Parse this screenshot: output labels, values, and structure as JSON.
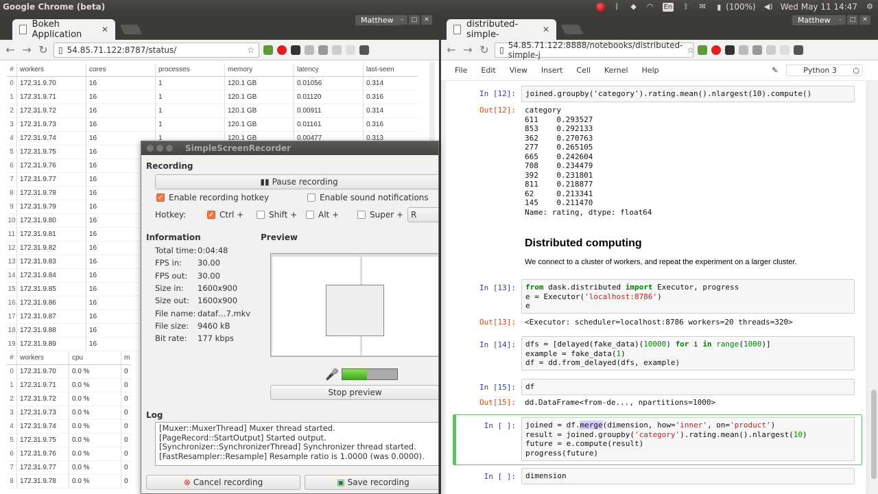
{
  "topbar": {
    "app_title": "Google Chrome (beta)",
    "battery": "(100%)",
    "clock": "Wed May 11 14:47",
    "keyboard": "En"
  },
  "left_window": {
    "tab_title": "Bokeh Application",
    "user": "Matthew",
    "url": "54.85.71.122:8787/status/",
    "table1": {
      "headers": [
        "#",
        "workers",
        "cores",
        "processes",
        "memory",
        "latency",
        "last-seen"
      ],
      "rows": [
        [
          "0",
          "172.31.9.70",
          "16",
          "1",
          "120.1 GB",
          "0.01056",
          "0.314"
        ],
        [
          "1",
          "172.31.9.71",
          "16",
          "1",
          "120.1 GB",
          "0.01120",
          "0.316"
        ],
        [
          "2",
          "172.31.9.72",
          "16",
          "1",
          "120.1 GB",
          "0.00911",
          "0.314"
        ],
        [
          "3",
          "172.31.9.73",
          "16",
          "1",
          "120.1 GB",
          "0.01161",
          "0.316"
        ],
        [
          "4",
          "172.31.9.74",
          "16",
          "1",
          "120.1 GB",
          "0.00477",
          "0.313"
        ],
        [
          "5",
          "172.31.9.75",
          "16",
          "",
          "",
          "",
          ""
        ],
        [
          "6",
          "172.31.9.76",
          "16",
          "",
          "",
          "",
          ""
        ],
        [
          "7",
          "172.31.9.77",
          "16",
          "",
          "",
          "",
          ""
        ],
        [
          "8",
          "172.31.9.78",
          "16",
          "",
          "",
          "",
          ""
        ],
        [
          "9",
          "172.31.9.79",
          "16",
          "",
          "",
          "",
          ""
        ],
        [
          "10",
          "172.31.9.80",
          "16",
          "",
          "",
          "",
          ""
        ],
        [
          "11",
          "172.31.9.81",
          "16",
          "",
          "",
          "",
          ""
        ],
        [
          "12",
          "172.31.9.82",
          "16",
          "",
          "",
          "",
          ""
        ],
        [
          "13",
          "172.31.9.83",
          "16",
          "",
          "",
          "",
          ""
        ],
        [
          "14",
          "172.31.9.84",
          "16",
          "",
          "",
          "",
          ""
        ],
        [
          "15",
          "172.31.9.85",
          "16",
          "",
          "",
          "",
          ""
        ],
        [
          "16",
          "172.31.9.86",
          "16",
          "",
          "",
          "",
          ""
        ],
        [
          "17",
          "172.31.9.87",
          "16",
          "",
          "",
          "",
          ""
        ],
        [
          "18",
          "172.31.9.88",
          "16",
          "",
          "",
          "",
          ""
        ],
        [
          "19",
          "172.31.9.89",
          "16",
          "",
          "",
          "",
          ""
        ]
      ]
    },
    "table2": {
      "headers": [
        "#",
        "workers",
        "cpu",
        "m"
      ],
      "rows": [
        [
          "0",
          "172.31.9.70",
          "0.0 %",
          "0"
        ],
        [
          "1",
          "172.31.9.71",
          "0.0 %",
          "0"
        ],
        [
          "2",
          "172.31.9.72",
          "0.0 %",
          "0"
        ],
        [
          "3",
          "172.31.9.73",
          "0.0 %",
          "0"
        ],
        [
          "4",
          "172.31.9.74",
          "0.0 %",
          "0"
        ],
        [
          "5",
          "172.31.9.75",
          "0.0 %",
          "0"
        ],
        [
          "6",
          "172.31.9.76",
          "0.0 %",
          "0"
        ],
        [
          "7",
          "172.31.9.77",
          "0.0 %",
          "0"
        ],
        [
          "8",
          "172.31.9.78",
          "0.0 %",
          "0"
        ]
      ]
    }
  },
  "ssr": {
    "title": "SimpleScreenRecorder",
    "recording_label": "Recording",
    "pause_button": "Pause recording",
    "enable_hotkey": "Enable recording hotkey",
    "enable_sound": "Enable sound notifications",
    "hotkey_label": "Hotkey:",
    "ctrl": "Ctrl +",
    "shift": "Shift +",
    "alt": "Alt +",
    "super": "Super +",
    "hotkey_value": "R",
    "information_label": "Information",
    "preview_label": "Preview",
    "info": [
      {
        "k": "Total time:",
        "v": "0:04:48"
      },
      {
        "k": "FPS in:",
        "v": "30.00"
      },
      {
        "k": "FPS out:",
        "v": "30.00"
      },
      {
        "k": "Size in:",
        "v": "1600x900"
      },
      {
        "k": "Size out:",
        "v": "1600x900"
      },
      {
        "k": "File name:",
        "v": "dataf…7.mkv"
      },
      {
        "k": "File size:",
        "v": "9460 kB"
      },
      {
        "k": "Bit rate:",
        "v": "177 kbps"
      }
    ],
    "stop_preview": "Stop preview",
    "audio_level": 0.45,
    "log_label": "Log",
    "log": [
      "[Muxer::MuxerThread] Muxer thread started.",
      "[PageRecord::StartOutput] Started output.",
      "[Synchronizer::SynchronizerThread] Synchronizer thread started.",
      "[FastResampler::Resample] Resample ratio is 1.0000 (was 0.0000)."
    ],
    "cancel_button": "Cancel recording",
    "save_button": "Save recording"
  },
  "right_window": {
    "tab_title": "distributed-simple-",
    "user": "Matthew",
    "url": "54.85.71.122:8888/notebooks/distributed-simple-j",
    "menu": [
      "File",
      "Edit",
      "View",
      "Insert",
      "Cell",
      "Kernel",
      "Help"
    ],
    "kernel": "Python 3",
    "in12_prompt": "In [12]:",
    "in12_code": "joined.groupby('category').rating.mean().nlargest(10).compute()",
    "out12_prompt": "Out[12]:",
    "out12_text": "category\n611    0.293527\n853    0.292133\n362    0.270763\n277    0.265105\n665    0.242604\n708    0.234479\n392    0.231801\n811    0.218877\n62     0.213341\n145    0.211470\nName: rating, dtype: float64",
    "heading": "Distributed computing",
    "paragraph": "We connect to a cluster of workers, and repeat the experiment on a larger cluster.",
    "in13_prompt": "In [13]:",
    "in13_l1_kw1": "from",
    "in13_l1_mid": " dask.distributed ",
    "in13_l1_kw2": "import",
    "in13_l1_rest": " Executor, progress",
    "in13_l2_a": "e = Executor(",
    "in13_l2_str": "'localhost:8786'",
    "in13_l2_b": ")",
    "in13_l3": "e",
    "out13_prompt": "Out[13]:",
    "out13_text": "<Executor: scheduler=localhost:8786 workers=20 threads=320>",
    "in14_prompt": "In [14]:",
    "in14_l1_a": "dfs = [delayed(fake_data)(",
    "in14_l1_n1": "10000",
    "in14_l1_b": ") ",
    "in14_l1_for": "for",
    "in14_l1_c": " i ",
    "in14_l1_in": "in",
    "in14_l1_d": " ",
    "in14_l1_range": "range",
    "in14_l1_e": "(",
    "in14_l1_n2": "1000",
    "in14_l1_f": ")]",
    "in14_l2_a": "example = fake_data(",
    "in14_l2_n": "1",
    "in14_l2_b": ")",
    "in14_l3": "df = dd.from_delayed(dfs, example)",
    "in15_prompt": "In [15]:",
    "in15_code": "df",
    "out15_prompt": "Out[15]:",
    "out15_text": "dd.DataFrame<from-de..., npartitions=1000>",
    "inA_prompt": "In [ ]:",
    "inA_l1_a": "joined = df.",
    "inA_l1_merge": "merge",
    "inA_l1_b": "(dimension, how=",
    "inA_l1_s1": "'inner'",
    "inA_l1_c": ", on=",
    "inA_l1_s2": "'product'",
    "inA_l1_d": ")",
    "inA_l2_a": "result = joined.groupby(",
    "inA_l2_s": "'category'",
    "inA_l2_b": ").rating.mean().nlargest(",
    "inA_l2_n": "10",
    "inA_l2_c": ")",
    "inA_l3": "future = e.compute(result)",
    "inA_l4": "progress(future)",
    "inB_prompt": "In [ ]:",
    "inB_code": "dimension"
  }
}
